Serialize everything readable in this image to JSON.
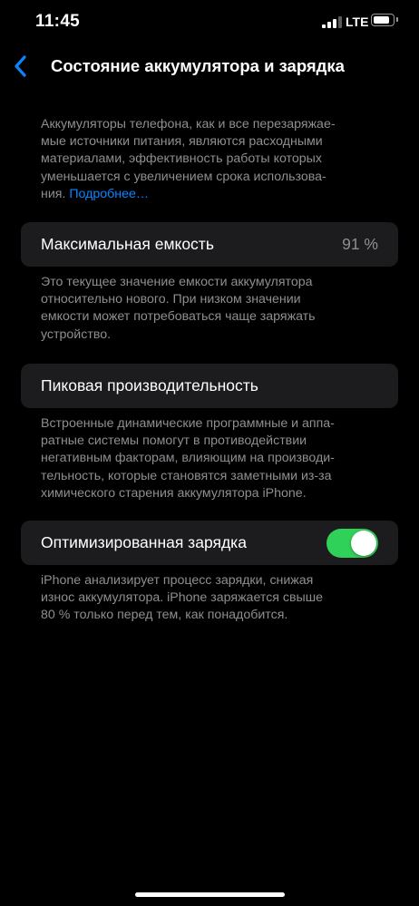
{
  "status_bar": {
    "time": "11:45",
    "network": "LTE",
    "signal_icon": "cellular-signal-icon",
    "battery_icon": "battery-icon"
  },
  "nav": {
    "back_icon": "chevron-left-icon",
    "title": "Состояние аккумулятора и зарядка"
  },
  "intro": {
    "lines": [
      "Аккумуляторы телефона, как и все перезаряжае-",
      "мые источники питания, являются расходными",
      "материалами, эффективность работы которых",
      "уменьшается с увеличением срока использова-"
    ],
    "last_line": "ния.",
    "link": "Подробнее…"
  },
  "max_capacity": {
    "label": "Максимальная емкость",
    "value": "91 %",
    "footer_lines": [
      "Это текущее значение емкости аккумулятора",
      "относительно нового. При низком значении",
      "емкости может потребоваться чаще заряжать",
      "устройство."
    ]
  },
  "peak_performance": {
    "label": "Пиковая производительность",
    "footer_lines": [
      "Встроенные динамические программные и аппа-",
      "ратные системы помогут в противодействии",
      "негативным факторам, влияющим на производи-",
      "тельность, которые становятся заметными из-за",
      "химического старения аккумулятора iPhone."
    ]
  },
  "optimized_charging": {
    "label": "Оптимизированная зарядка",
    "enabled": true,
    "footer_lines": [
      "iPhone анализирует процесс зарядки, снижая",
      "износ аккумулятора. iPhone заряжается свыше",
      "80 % только перед тем, как понадобится."
    ]
  },
  "colors": {
    "background": "#000000",
    "cell_background": "#1c1c1e",
    "secondary_text": "#8e8e93",
    "link": "#0a84ff",
    "toggle_on": "#30d158"
  },
  "battery_level": 0.85
}
